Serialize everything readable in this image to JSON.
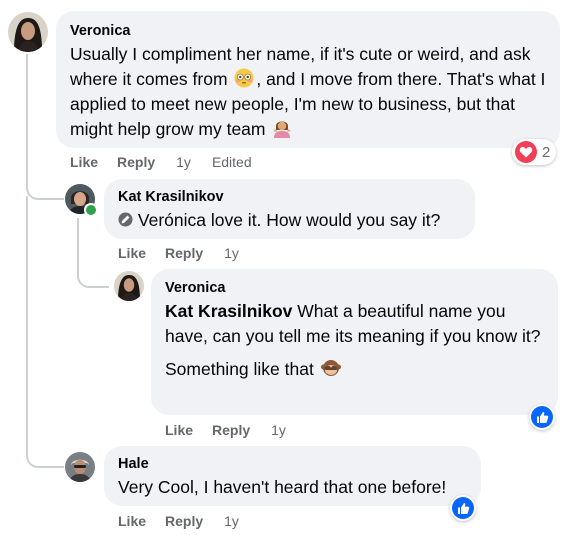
{
  "comments": [
    {
      "author": "Veronica",
      "text": "Usually I compliment her name, if it's cute or weird, and ask where it comes from",
      "text_after_emoji1": ", and I move from there. That's what I applied to meet new people, I'm new to business, but that might help grow my team",
      "emoji1": "flushed-face-emoji",
      "emoji2": "woman-shrugging-emoji",
      "like_label": "Like",
      "reply_label": "Reply",
      "time": "1y",
      "edited": "Edited",
      "reaction_icon": "heart-reaction-icon",
      "reaction_count": "2",
      "colors": {
        "heart": "#f33e58"
      }
    },
    {
      "author": "Kat Krasilnikov",
      "mention": "Verónica",
      "text": " love it. How would you say it?",
      "like_label": "Like",
      "reply_label": "Reply",
      "time": "1y",
      "status": "online"
    },
    {
      "author": "Veronica",
      "mention": "Kat Krasilnikov",
      "text": " What a beautiful name you have, can you tell me its meaning if you know it?",
      "text2": "Something like that",
      "emoji": "see-no-evil-monkey-emoji",
      "like_label": "Like",
      "reply_label": "Reply",
      "time": "1y",
      "reaction_icon": "like-reaction-icon"
    },
    {
      "author": "Hale",
      "text": "Very Cool, I haven't heard that one before!",
      "like_label": "Like",
      "reply_label": "Reply",
      "time": "1y",
      "reaction_icon": "like-reaction-icon"
    }
  ],
  "colors": {
    "bubble": "#f0f2f5",
    "meta": "#65676b",
    "like_blue": "#0866ff",
    "online": "#31a24c"
  }
}
